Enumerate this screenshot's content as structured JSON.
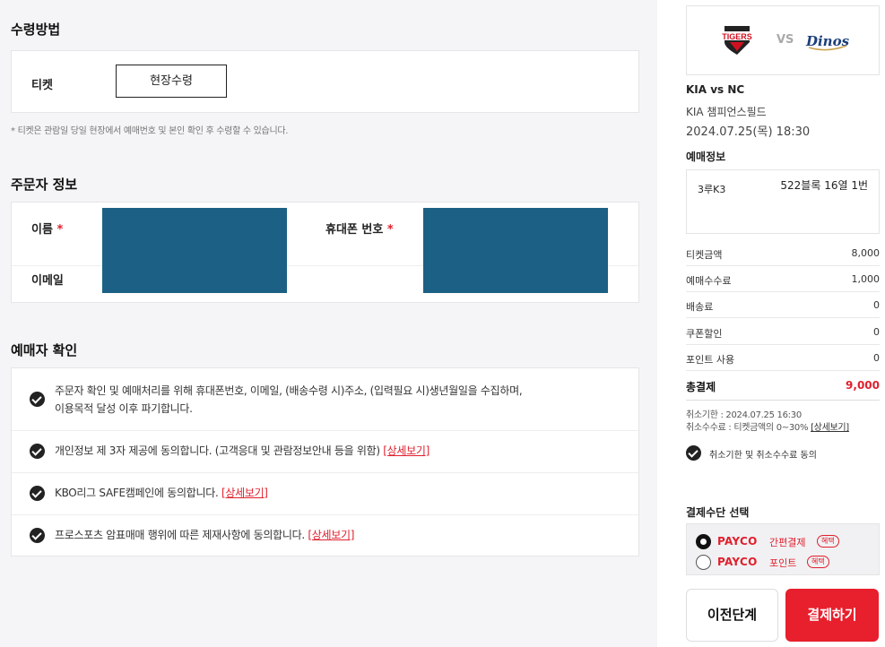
{
  "pickup": {
    "section_title": "수령방법",
    "ticket_label": "티켓",
    "method_button": "현장수령",
    "note": "* 티켓은 관람일 당일 현장에서 예매번호 및 본인 확인 후 수령할 수 있습니다."
  },
  "orderer": {
    "section_title": "주문자 정보",
    "name_label": "이름",
    "phone_label": "휴대폰 번호",
    "email_label": "이메일",
    "required_mark": "*"
  },
  "confirm": {
    "section_title": "예매자 확인",
    "items": [
      {
        "text": "주문자 확인 및 예매처리를 위해 휴대폰번호, 이메일, (배송수령 시)주소, (입력필요 시)생년월일을 수집하며,",
        "text2": "이용목적 달성 이후 파기합니다.",
        "link": ""
      },
      {
        "text": "개인정보 제 3자 제공에 동의합니다. (고객응대 및 관람정보안내 등을 위함) ",
        "link": "[상세보기]"
      },
      {
        "text": "KBO리그 SAFE캠페인에 동의합니다. ",
        "link": "[상세보기]"
      },
      {
        "text": "프로스포츠 암표매매 행위에 따른 제재사항에 동의합니다. ",
        "link": "[상세보기]"
      }
    ]
  },
  "match": {
    "home_logo": "TIGERS",
    "vs": "VS",
    "away_logo": "Dinos",
    "title": "KIA vs NC",
    "venue": "KIA 챔피언스필드",
    "datetime": "2024.07.25(목) 18:30"
  },
  "booking": {
    "title": "예매정보",
    "zone": "3루K3",
    "seat": "522블록 16열 1번"
  },
  "prices": [
    {
      "label": "티켓금액",
      "value": "8,000"
    },
    {
      "label": "예매수수료",
      "value": "1,000"
    },
    {
      "label": "배송료",
      "value": "0"
    },
    {
      "label": "쿠폰할인",
      "value": "0"
    },
    {
      "label": "포인트 사용",
      "value": "0"
    }
  ],
  "total": {
    "label": "총결제",
    "value": "9,000"
  },
  "cancel": {
    "deadline": "취소기한 : 2024.07.25 16:30",
    "fee": "취소수수료 : 티켓금액의 0~30% ",
    "fee_link": "[상세보기]",
    "agree": "취소기한 및 취소수수료 동의"
  },
  "payment": {
    "title": "결제수단 선택",
    "options": [
      {
        "brand": "PAYCO",
        "kind": "간편결제",
        "benefit": "혜택",
        "selected": true
      },
      {
        "brand": "PAYCO",
        "kind": "포인트",
        "benefit": "혜택",
        "selected": false
      }
    ]
  },
  "buttons": {
    "prev": "이전단계",
    "pay": "결제하기"
  },
  "colors": {
    "accent": "#e81f2d",
    "mask": "#1c6185"
  }
}
